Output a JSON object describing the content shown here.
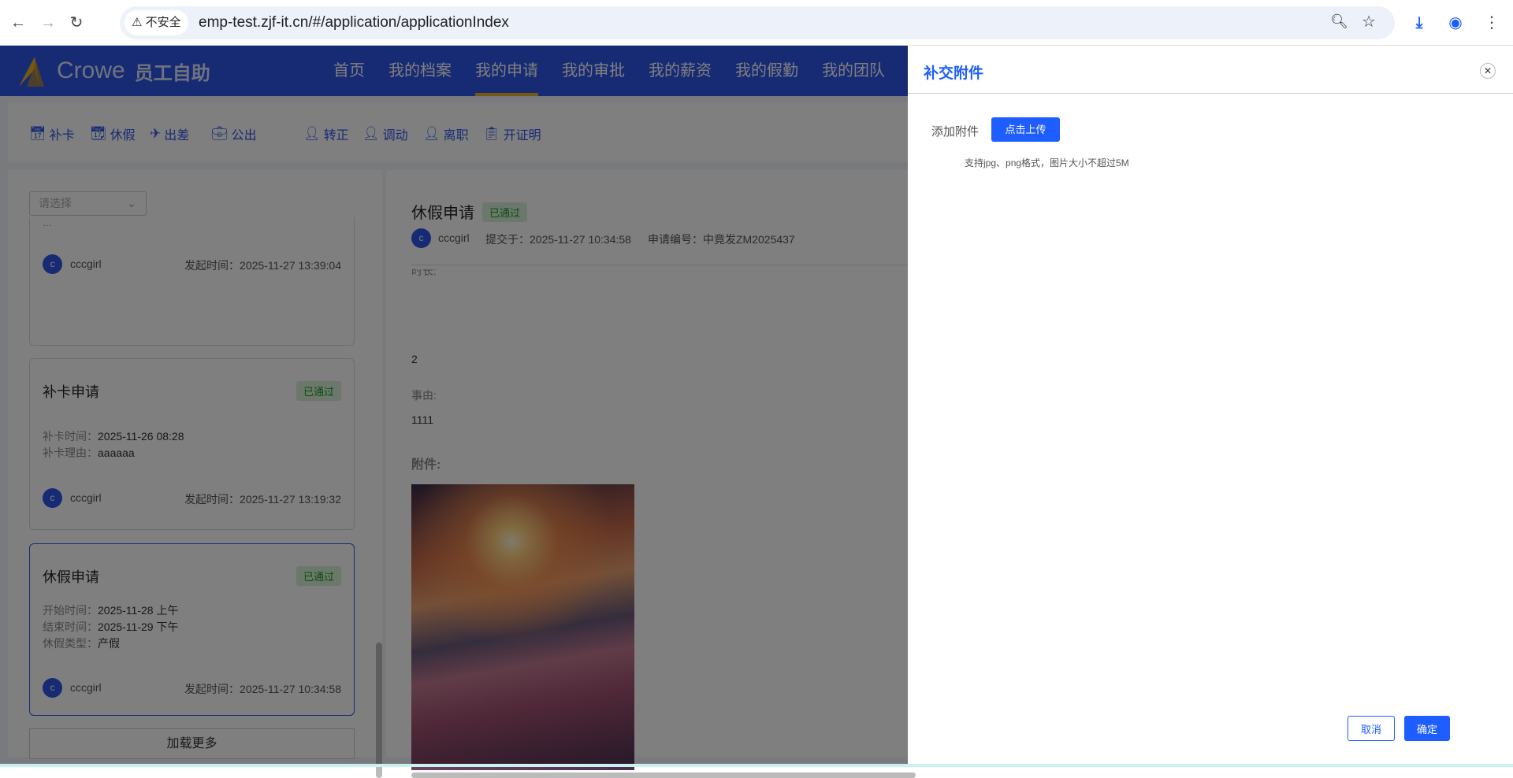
{
  "browser": {
    "security": "不安全",
    "url": "emp-test.zjf-it.cn/#/application/applicationIndex"
  },
  "header": {
    "brand": "Crowe",
    "brand_sub": "员工自助",
    "nav": [
      "首页",
      "我的档案",
      "我的申请",
      "我的审批",
      "我的薪资",
      "我的假勤",
      "我的团队"
    ],
    "active": "我的申请"
  },
  "toolbar": [
    "补卡",
    "休假",
    "出差",
    "公出",
    "转正",
    "调动",
    "离职",
    "开证明"
  ],
  "list": {
    "select_placeholder": "请选择",
    "partial_top_text": "…",
    "cards": [
      {
        "user": "cccgirl",
        "avatar": "c",
        "time_label": "发起时间：",
        "time": "2025-11-27 13:39:04"
      },
      {
        "title": "补卡申请",
        "status": "已通过",
        "fields": [
          {
            "label": "补卡时间：",
            "value": "2025-11-26 08:28"
          },
          {
            "label": "补卡理由：",
            "value": "aaaaaa"
          }
        ],
        "user": "cccgirl",
        "avatar": "c",
        "time_label": "发起时间：",
        "time": "2025-11-27 13:19:32"
      },
      {
        "title": "休假申请",
        "status": "已通过",
        "fields": [
          {
            "label": "开始时间：",
            "value": "2025-11-28 上午"
          },
          {
            "label": "结束时间：",
            "value": "2025-11-29 下午"
          },
          {
            "label": "休假类型：",
            "value": "产假"
          }
        ],
        "user": "cccgirl",
        "avatar": "c",
        "time_label": "发起时间：",
        "time": "2025-11-27 10:34:58"
      }
    ],
    "load_more": "加载更多"
  },
  "detail": {
    "title": "休假申请",
    "status": "已通过",
    "avatar": "c",
    "user": "cccgirl",
    "submitted": "提交于：2025-11-27 10:34:58",
    "number": "申请编号：中竟发ZM2025437",
    "duration_label": "时长:",
    "duration": "2",
    "reason_label": "事由:",
    "reason": "1111",
    "attachment_label": "附件:"
  },
  "modal": {
    "title": "补交附件",
    "add_label": "添加附件",
    "upload": "点击上传",
    "hint": "支持jpg、png格式，图片大小不超过5M",
    "cancel": "取消",
    "ok": "确定"
  },
  "colors": {
    "primary": "#1e5eff",
    "header": "#2f55e8",
    "success": "#1e9a26"
  }
}
